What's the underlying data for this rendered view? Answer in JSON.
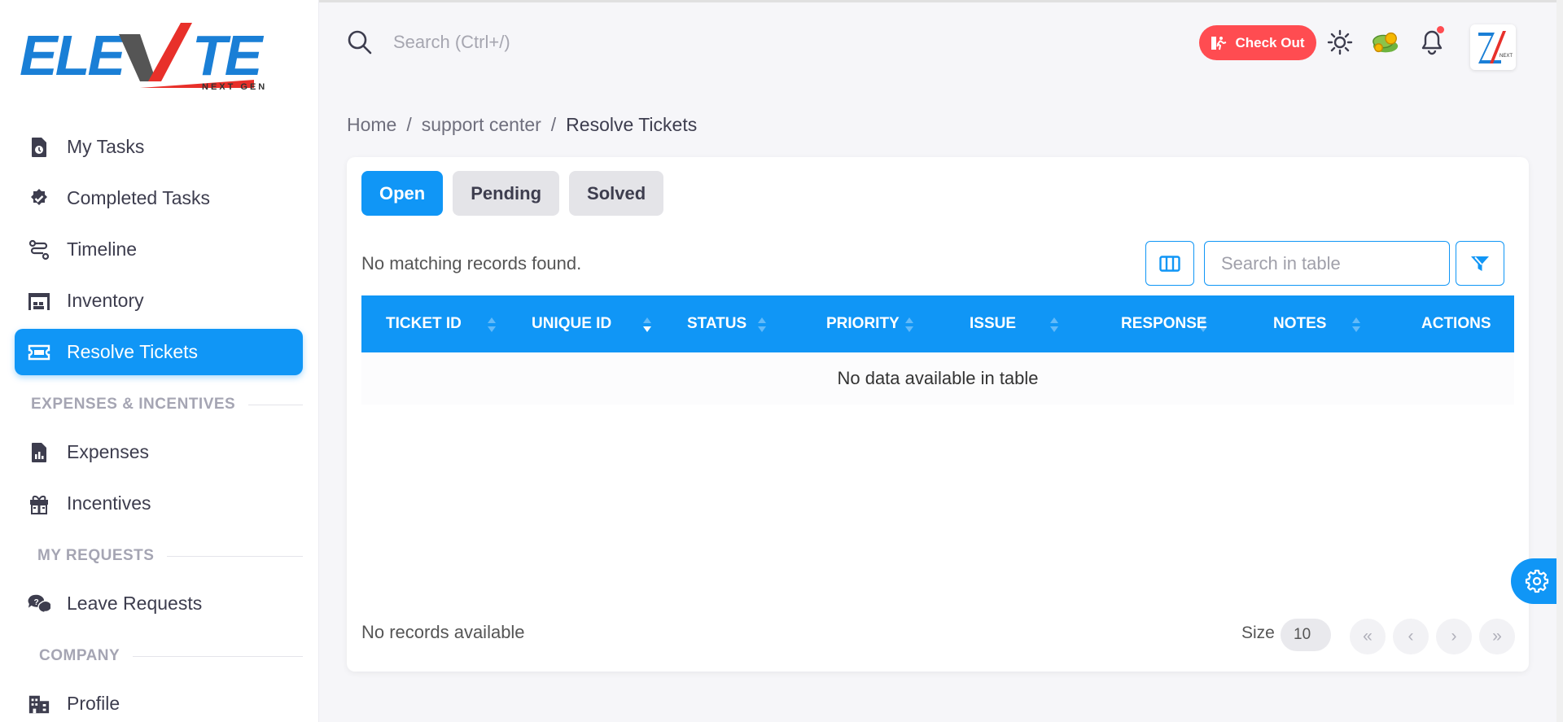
{
  "app": {
    "logo_text": "ELEVATE",
    "logo_sub": "NEXT GEN"
  },
  "sidebar": {
    "items": [
      {
        "label": "My Tasks",
        "icon": "file-clock-icon"
      },
      {
        "label": "Completed Tasks",
        "icon": "badge-check-icon"
      },
      {
        "label": "Timeline",
        "icon": "route-icon"
      },
      {
        "label": "Inventory",
        "icon": "warehouse-icon"
      },
      {
        "label": "Resolve Tickets",
        "icon": "ticket-icon",
        "active": true
      }
    ],
    "section_expenses": "EXPENSES & INCENTIVES",
    "expenses_items": [
      {
        "label": "Expenses",
        "icon": "file-chart-icon"
      },
      {
        "label": "Incentives",
        "icon": "gift-icon"
      }
    ],
    "section_requests": "MY REQUESTS",
    "requests_items": [
      {
        "label": "Leave Requests",
        "icon": "chat-question-icon"
      }
    ],
    "section_company": "COMPANY",
    "company_items": [
      {
        "label": "Profile",
        "icon": "building-icon"
      }
    ]
  },
  "header": {
    "search_placeholder": "Search (Ctrl+/)",
    "checkout_label": "Check Out"
  },
  "breadcrumb": {
    "home": "Home",
    "section": "support center",
    "current": "Resolve Tickets"
  },
  "tabs": [
    {
      "label": "Open",
      "active": true
    },
    {
      "label": "Pending"
    },
    {
      "label": "Solved"
    }
  ],
  "table": {
    "empty_message": "No matching records found.",
    "search_placeholder": "Search in table",
    "columns": [
      "TICKET ID",
      "UNIQUE ID",
      "STATUS",
      "PRIORITY",
      "ISSUE",
      "RESPONSE",
      "NOTES",
      "ACTIONS"
    ],
    "no_data": "No data available in table",
    "footer_message": "No records available",
    "size_label": "Size",
    "size_value": "10",
    "pager": [
      "«",
      "‹",
      "›",
      "»"
    ]
  },
  "colors": {
    "primary": "#1096f6",
    "danger": "#ff4c51"
  }
}
